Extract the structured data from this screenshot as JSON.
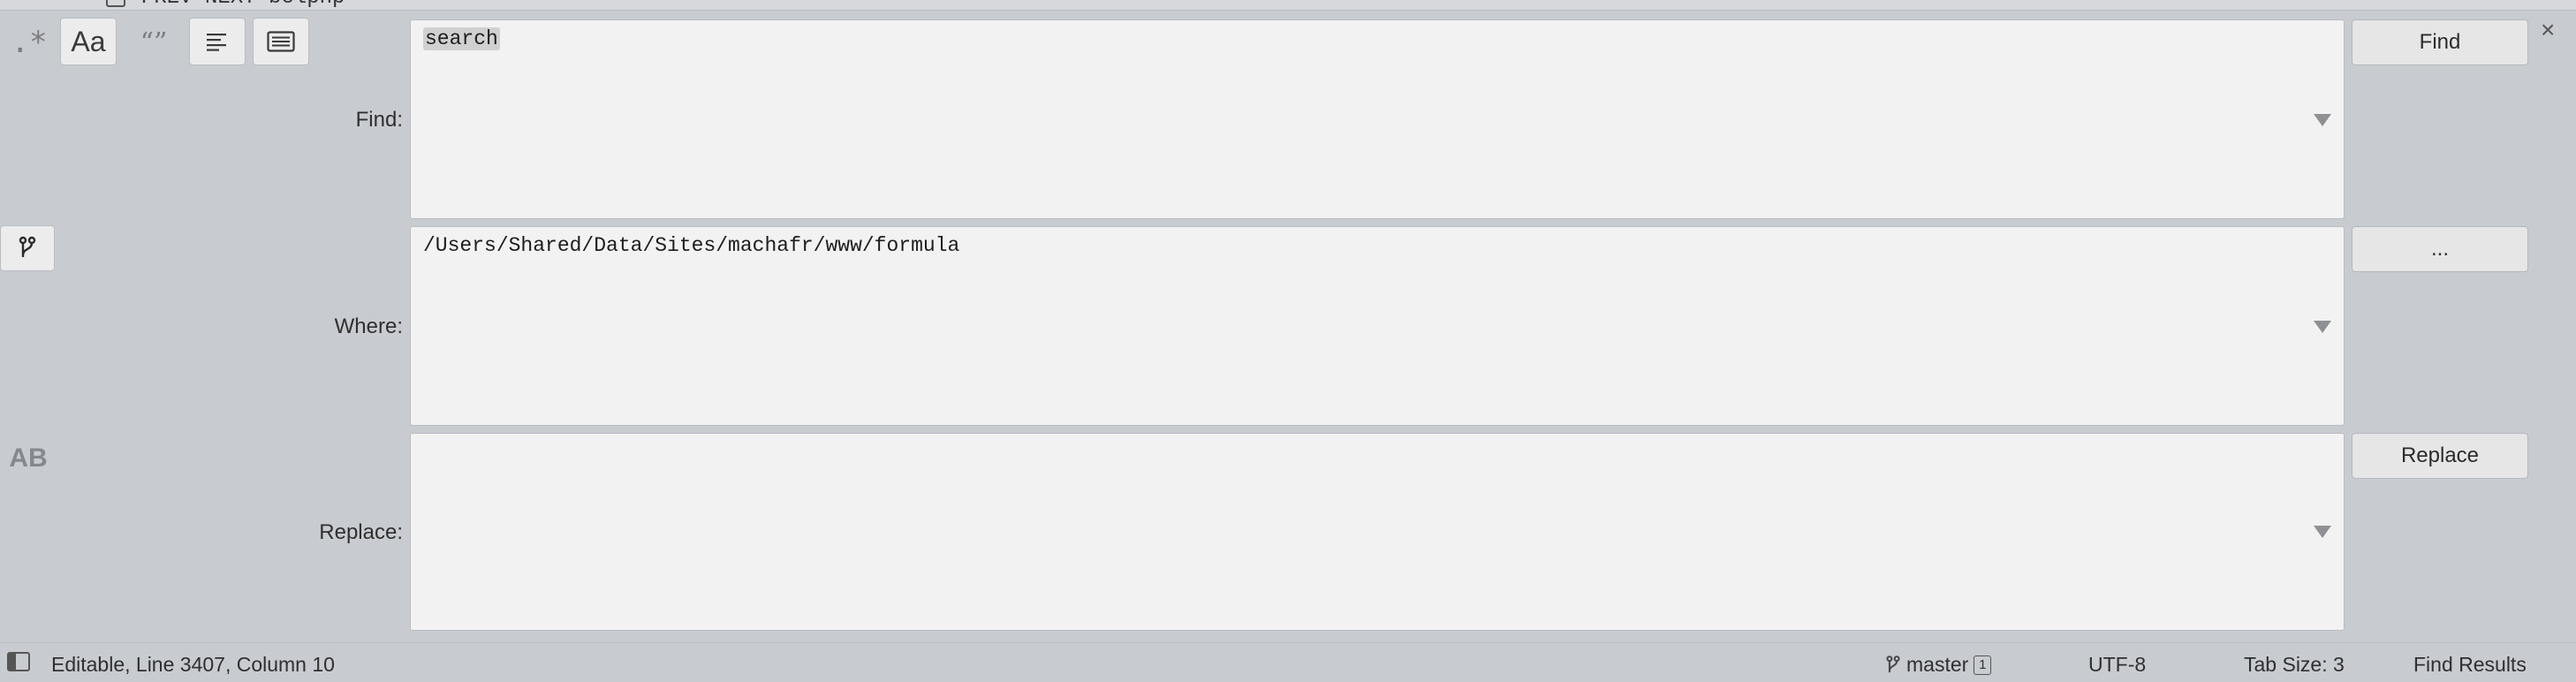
{
  "top_partial_text": "PREV NEXT belphp",
  "options": {
    "regex_label": ".*",
    "case_label": "Aa",
    "wrap_label": "“”"
  },
  "find": {
    "label": "Find:",
    "value": "search",
    "button": "Find"
  },
  "where": {
    "label": "Where:",
    "value": "/Users/Shared/Data/Sites/machafr/www/formula",
    "button": "..."
  },
  "replace": {
    "label": "Replace:",
    "value": "",
    "button": "Replace",
    "preserve_case_label": "AB"
  },
  "close_label": "×",
  "status": {
    "position": "Editable, Line 3407, Column 10",
    "branch": "master",
    "branch_count": "1",
    "encoding": "UTF-8",
    "tab_size": "Tab Size: 3",
    "syntax": "Find Results"
  }
}
